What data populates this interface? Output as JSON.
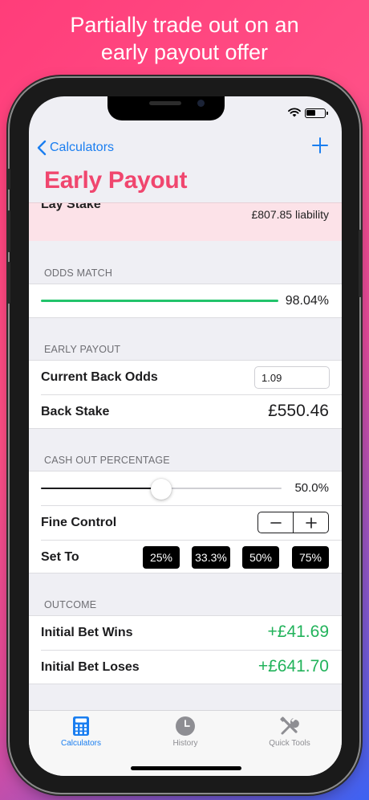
{
  "banner": {
    "line1": "Partially trade out on an",
    "line2": "early payout offer"
  },
  "nav": {
    "back_label": "Calculators",
    "title": "Early Payout"
  },
  "lay_stake": {
    "label": "Lay Stake",
    "ghost_value": "",
    "liability": "£807.85 liability"
  },
  "odds_match": {
    "header": "ODDS MATCH",
    "value_text": "98.04%",
    "value": 98.04
  },
  "early_payout": {
    "header": "EARLY PAYOUT",
    "current_back_odds_label": "Current Back Odds",
    "current_back_odds_value": "1.09",
    "back_stake_label": "Back Stake",
    "back_stake_value": "£550.46"
  },
  "cash_out": {
    "header": "CASH OUT PERCENTAGE",
    "percentage_text": "50.0%",
    "percentage": 0.5,
    "fine_control_label": "Fine Control",
    "set_to_label": "Set To",
    "presets": [
      "25%",
      "33.3%",
      "50%",
      "75%"
    ]
  },
  "outcome": {
    "header": "OUTCOME",
    "wins_label": "Initial Bet Wins",
    "wins_value": "+£41.69",
    "loses_label": "Initial Bet Loses",
    "loses_value": "+£641.70"
  },
  "tabs": [
    {
      "label": "Calculators",
      "icon": "calculator-icon",
      "active": true
    },
    {
      "label": "History",
      "icon": "clock-icon",
      "active": false
    },
    {
      "label": "Quick Tools",
      "icon": "tools-icon",
      "active": false
    }
  ],
  "colors": {
    "accent": "#1a7ef0",
    "title": "#f0466e",
    "positive": "#22b35b",
    "match_bar": "#22c46b"
  }
}
